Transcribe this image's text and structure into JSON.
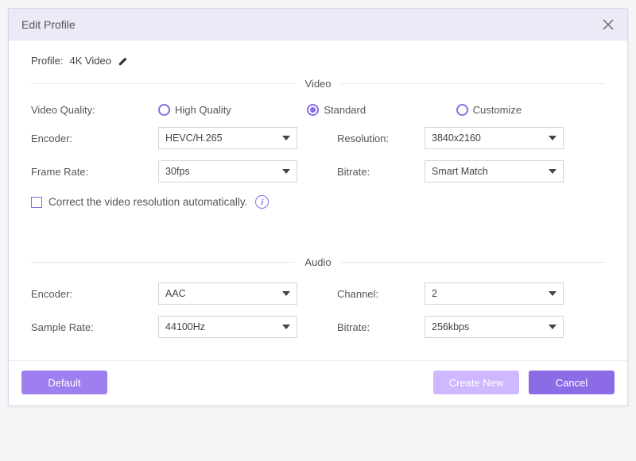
{
  "titlebar": {
    "title": "Edit Profile"
  },
  "profile": {
    "label": "Profile:",
    "name": "4K Video"
  },
  "sections": {
    "video": "Video",
    "audio": "Audio"
  },
  "video": {
    "quality_label": "Video Quality:",
    "options": {
      "high": "High Quality",
      "standard": "Standard",
      "customize": "Customize"
    },
    "encoder_label": "Encoder:",
    "encoder_value": "HEVC/H.265",
    "resolution_label": "Resolution:",
    "resolution_value": "3840x2160",
    "framerate_label": "Frame Rate:",
    "framerate_value": "30fps",
    "bitrate_label": "Bitrate:",
    "bitrate_value": "Smart Match",
    "auto_resolution": "Correct the video resolution automatically."
  },
  "audio": {
    "encoder_label": "Encoder:",
    "encoder_value": "AAC",
    "channel_label": "Channel:",
    "channel_value": "2",
    "samplerate_label": "Sample Rate:",
    "samplerate_value": "44100Hz",
    "bitrate_label": "Bitrate:",
    "bitrate_value": "256kbps"
  },
  "buttons": {
    "default": "Default",
    "create_new": "Create New",
    "cancel": "Cancel"
  }
}
